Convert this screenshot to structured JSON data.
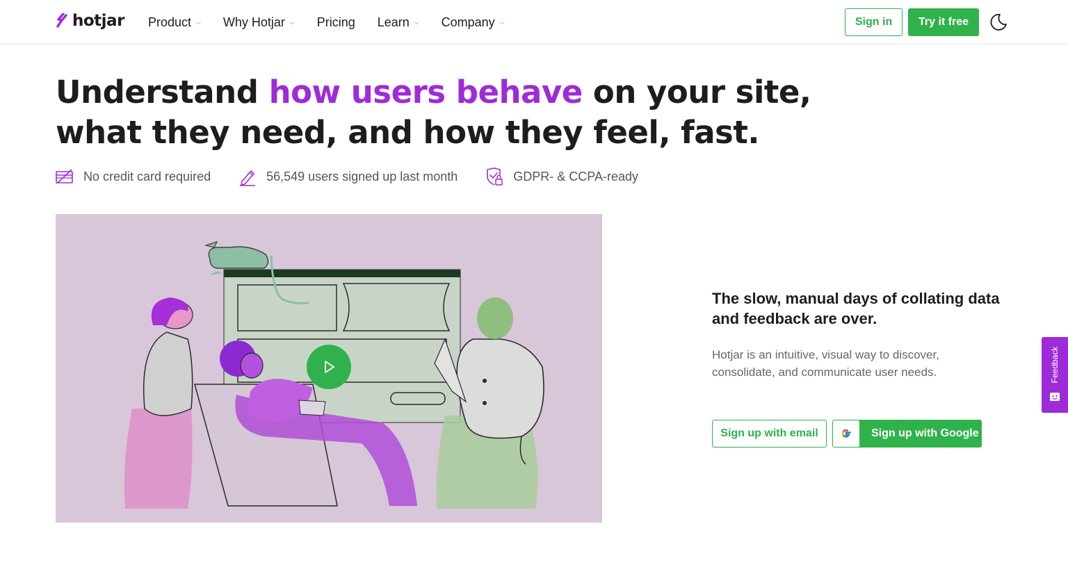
{
  "brand": {
    "name": "hotjar",
    "accent_color": "#9e2bd8",
    "cta_color": "#2fb24b"
  },
  "nav": {
    "items": [
      {
        "label": "Product",
        "has_dropdown": true
      },
      {
        "label": "Why Hotjar",
        "has_dropdown": true
      },
      {
        "label": "Pricing",
        "has_dropdown": false
      },
      {
        "label": "Learn",
        "has_dropdown": true
      },
      {
        "label": "Company",
        "has_dropdown": true
      }
    ],
    "signin_label": "Sign in",
    "try_label": "Try it free",
    "theme_icon": "moon-icon"
  },
  "hero": {
    "headline_before": "Understand ",
    "headline_accent": "how users behave",
    "headline_after": " on your site, what they need, and how they feel, fast.",
    "perks": [
      {
        "icon": "credit-card-crossed-icon",
        "text": "No credit card required"
      },
      {
        "icon": "pencil-icon",
        "text": "56,549 users signed up last month"
      },
      {
        "icon": "shield-lock-icon",
        "text": "GDPR- & CCPA-ready"
      }
    ],
    "video_play_icon": "play-icon"
  },
  "pitch": {
    "subhead": "The slow, manual days of collating data and feedback are over.",
    "description": "Hotjar is an intuitive, visual way to discover, consolidate, and communicate user needs.",
    "email_button": "Sign up with email",
    "google_button": "Sign up with Google"
  },
  "feedback_tab": {
    "label": "Feedback"
  }
}
